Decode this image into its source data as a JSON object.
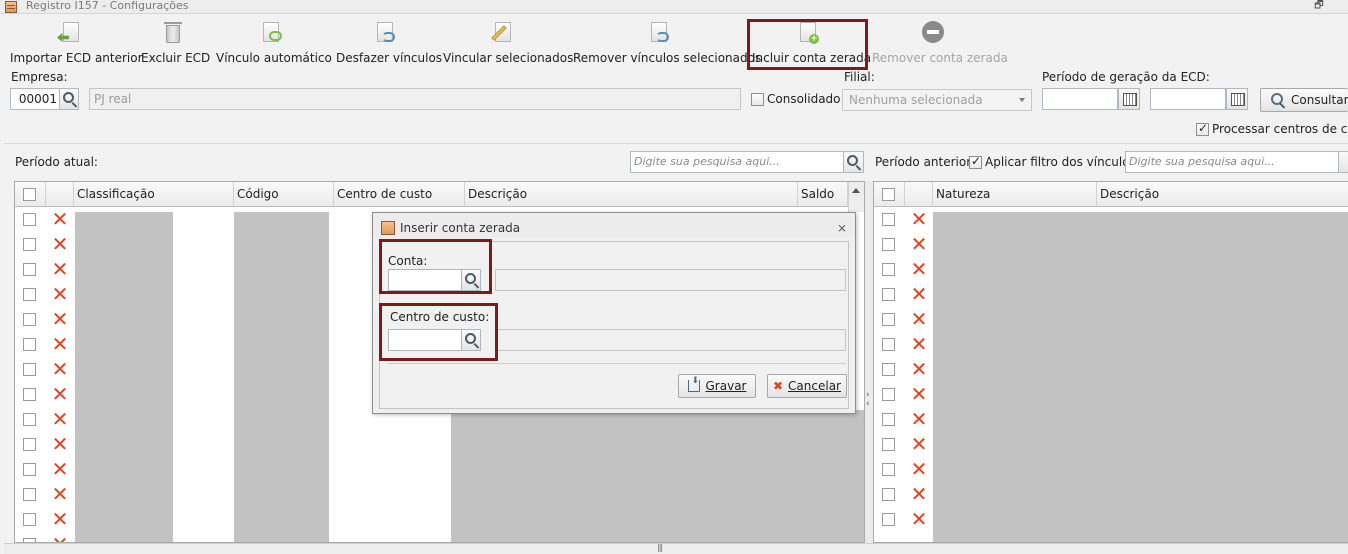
{
  "window": {
    "title": "Registro I157 - Configurações"
  },
  "toolbar": {
    "items": [
      {
        "label": "Importar ECD anterior",
        "icon": "import-icon"
      },
      {
        "label": "Excluir ECD",
        "icon": "trash-icon"
      },
      {
        "label": "Vínculo automático",
        "icon": "auto-link-icon"
      },
      {
        "label": "Desfazer vínculos",
        "icon": "undo-link-icon"
      },
      {
        "label": "Vincular selecionados",
        "icon": "link-selected-icon"
      },
      {
        "label": "Remover vínculos selecionados",
        "icon": "remove-links-icon"
      },
      {
        "label": "Incluir conta zerada",
        "icon": "add-document-icon"
      },
      {
        "label": "Remover conta zerada",
        "icon": "remove-circle-icon"
      }
    ]
  },
  "form": {
    "empresa_label": "Empresa:",
    "empresa_code": "00001",
    "empresa_name": "PJ real",
    "consolidado_label": "Consolidado",
    "filial_label": "Filial:",
    "filial_value": "Nenhuma selecionada",
    "periodo_label": "Período de geração da ECD:",
    "consultar_label": "Consultar",
    "processar_label": "Processar centros de custo"
  },
  "left_panel": {
    "label": "Período atual:",
    "search_placeholder": "Digite sua pesquisa aqui...",
    "columns": [
      "Classificação",
      "Código",
      "Centro de custo",
      "Descrição",
      "Saldo"
    ]
  },
  "right_panel": {
    "label": "Período anterior:",
    "filter_label": "Aplicar filtro dos vínculos",
    "search_placeholder": "Digite sua pesquisa aqui...",
    "columns": [
      "Natureza",
      "Descrição"
    ]
  },
  "dialog": {
    "title": "Inserir conta zerada",
    "conta_label": "Conta:",
    "centro_label": "Centro de custo:",
    "gravar_label": "Gravar",
    "cancelar_label": "Cancelar"
  },
  "colors": {
    "highlight": "#7b1c1c",
    "delete": "#e0431d"
  }
}
